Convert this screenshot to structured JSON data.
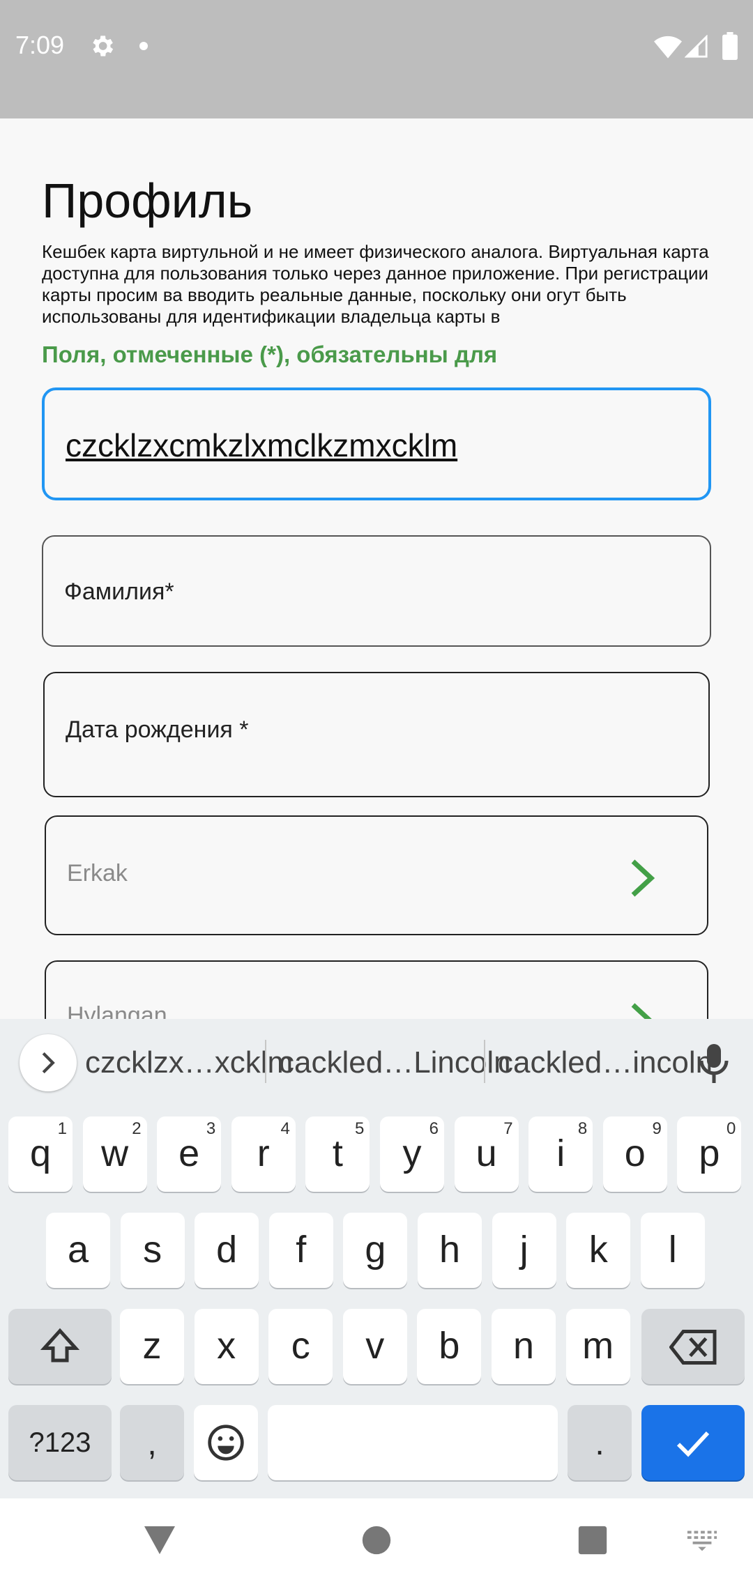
{
  "status_bar": {
    "time": "7:09",
    "icons": [
      "gear-icon",
      "notification-dot-icon",
      "wifi-icon",
      "signal-icon",
      "battery-icon"
    ]
  },
  "page": {
    "title": "Профиль",
    "description": "Кешбек карта виртульной и не имеет физического аналога. Виртуальная карта доступна для пользования только через данное приложение. При регистрации карты просим ва вводить реальные данные, поскольку они огут быть использованы для идентификации владельца карты в",
    "required_note": "Поля, отмеченные (*), обязательны для"
  },
  "form": {
    "name_value": "czcklzxcmkzlxmclkzmxcklm",
    "surname_label": "Фамилия*",
    "birthdate_label": "Дата рождения *",
    "gender_value": "Erkak",
    "city_value": "Hylangan"
  },
  "keyboard": {
    "suggestions": [
      "czcklzx…xcklm",
      "cackled…Lincoln",
      "cackled…incoln"
    ],
    "row1": [
      {
        "k": "q",
        "h": "1"
      },
      {
        "k": "w",
        "h": "2"
      },
      {
        "k": "e",
        "h": "3"
      },
      {
        "k": "r",
        "h": "4"
      },
      {
        "k": "t",
        "h": "5"
      },
      {
        "k": "y",
        "h": "6"
      },
      {
        "k": "u",
        "h": "7"
      },
      {
        "k": "i",
        "h": "8"
      },
      {
        "k": "o",
        "h": "9"
      },
      {
        "k": "p",
        "h": "0"
      }
    ],
    "row2": [
      "a",
      "s",
      "d",
      "f",
      "g",
      "h",
      "j",
      "k",
      "l"
    ],
    "row3": [
      "z",
      "x",
      "c",
      "v",
      "b",
      "n",
      "m"
    ],
    "symbols_label": "?123",
    "comma": ",",
    "period": ".",
    "accent_color": "#1a73e8"
  },
  "colors": {
    "required_note": "#4a9a4a",
    "focused_field": "#2196f3",
    "chevron": "#43a047"
  }
}
